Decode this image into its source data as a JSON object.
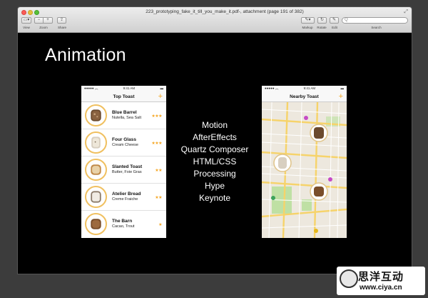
{
  "window": {
    "title": "223_prototyping_fake_it_till_you_make_it.pdf-, attachment (page 191 of 382)",
    "toolbar": {
      "view_label": "View",
      "zoom_label": "Zoom",
      "share_label": "Share",
      "markup_label": "Markup",
      "rotate_label": "Rotate",
      "edit_label": "Edit",
      "search_label": "Search",
      "search_placeholder": "Q"
    }
  },
  "slide": {
    "title": "Animation",
    "tools": [
      "Motion",
      "AfterEffects",
      "Quartz Composer",
      "HTML/CSS",
      "Processing",
      "Hype",
      "Keynote"
    ]
  },
  "left_phone": {
    "time": "9:41 AM",
    "nav_title": "Top Toast",
    "add_symbol": "+",
    "items": [
      {
        "name": "Blue Barrel",
        "sub": "Nutella, Sea Salt",
        "stars": "★★★"
      },
      {
        "name": "Four Glass",
        "sub": "Cream Cheese",
        "stars": "★★★"
      },
      {
        "name": "Slanted Toast",
        "sub": "Butter, Foie Gras",
        "stars": "★★"
      },
      {
        "name": "Atelier Bread",
        "sub": "Creme Fraiche",
        "stars": "★★"
      },
      {
        "name": "The Barn",
        "sub": "Cacao, Trout",
        "stars": "★"
      }
    ]
  },
  "right_phone": {
    "time": "9:41 AM",
    "nav_title": "Nearby Toast",
    "add_symbol": "+"
  },
  "watermark": {
    "cn": "思洋互动",
    "url": "www.ciya.cn"
  }
}
